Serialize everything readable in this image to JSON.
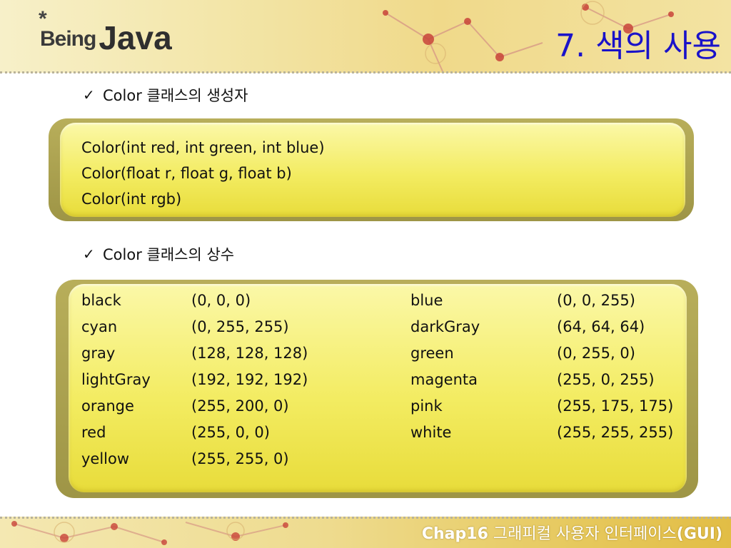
{
  "header": {
    "logo_star": "*",
    "logo_being": "Being",
    "logo_java": "Java",
    "title": "7. 색의 사용"
  },
  "section1": {
    "bullet": "Color 클래스의 생성자",
    "lines": [
      "Color(int red, int green, int blue)",
      "Color(float r, float g, float b)",
      "Color(int rgb)"
    ]
  },
  "section2": {
    "bullet": "Color 클래스의 상수",
    "left": [
      {
        "name": "black",
        "rgb": "(0, 0, 0)"
      },
      {
        "name": "cyan",
        "rgb": "(0, 255, 255)"
      },
      {
        "name": "gray",
        "rgb": "(128, 128, 128)"
      },
      {
        "name": "lightGray",
        "rgb": "(192, 192, 192)"
      },
      {
        "name": "orange",
        "rgb": "(255, 200, 0)"
      },
      {
        "name": "red",
        "rgb": "(255, 0, 0)"
      },
      {
        "name": "yellow",
        "rgb": "(255, 255, 0)"
      }
    ],
    "right": [
      {
        "name": "blue",
        "rgb": "(0, 0, 255)"
      },
      {
        "name": "darkGray",
        "rgb": "(64, 64, 64)"
      },
      {
        "name": "green",
        "rgb": "(0, 255, 0)"
      },
      {
        "name": "magenta",
        "rgb": "(255, 0, 255)"
      },
      {
        "name": "pink",
        "rgb": "(255, 175, 175)"
      },
      {
        "name": "white",
        "rgb": "(255, 255, 255)"
      }
    ]
  },
  "footer": {
    "chap": "Chap16",
    "title_main": "그래피컬 사용자 인터페이스",
    "title_suffix": "(GUI)"
  },
  "colors": {
    "title": "#1a12c9",
    "box_fill": "#f3ec62",
    "box_border": "#a89f4c"
  },
  "icons": {
    "bullet": "check-icon"
  }
}
